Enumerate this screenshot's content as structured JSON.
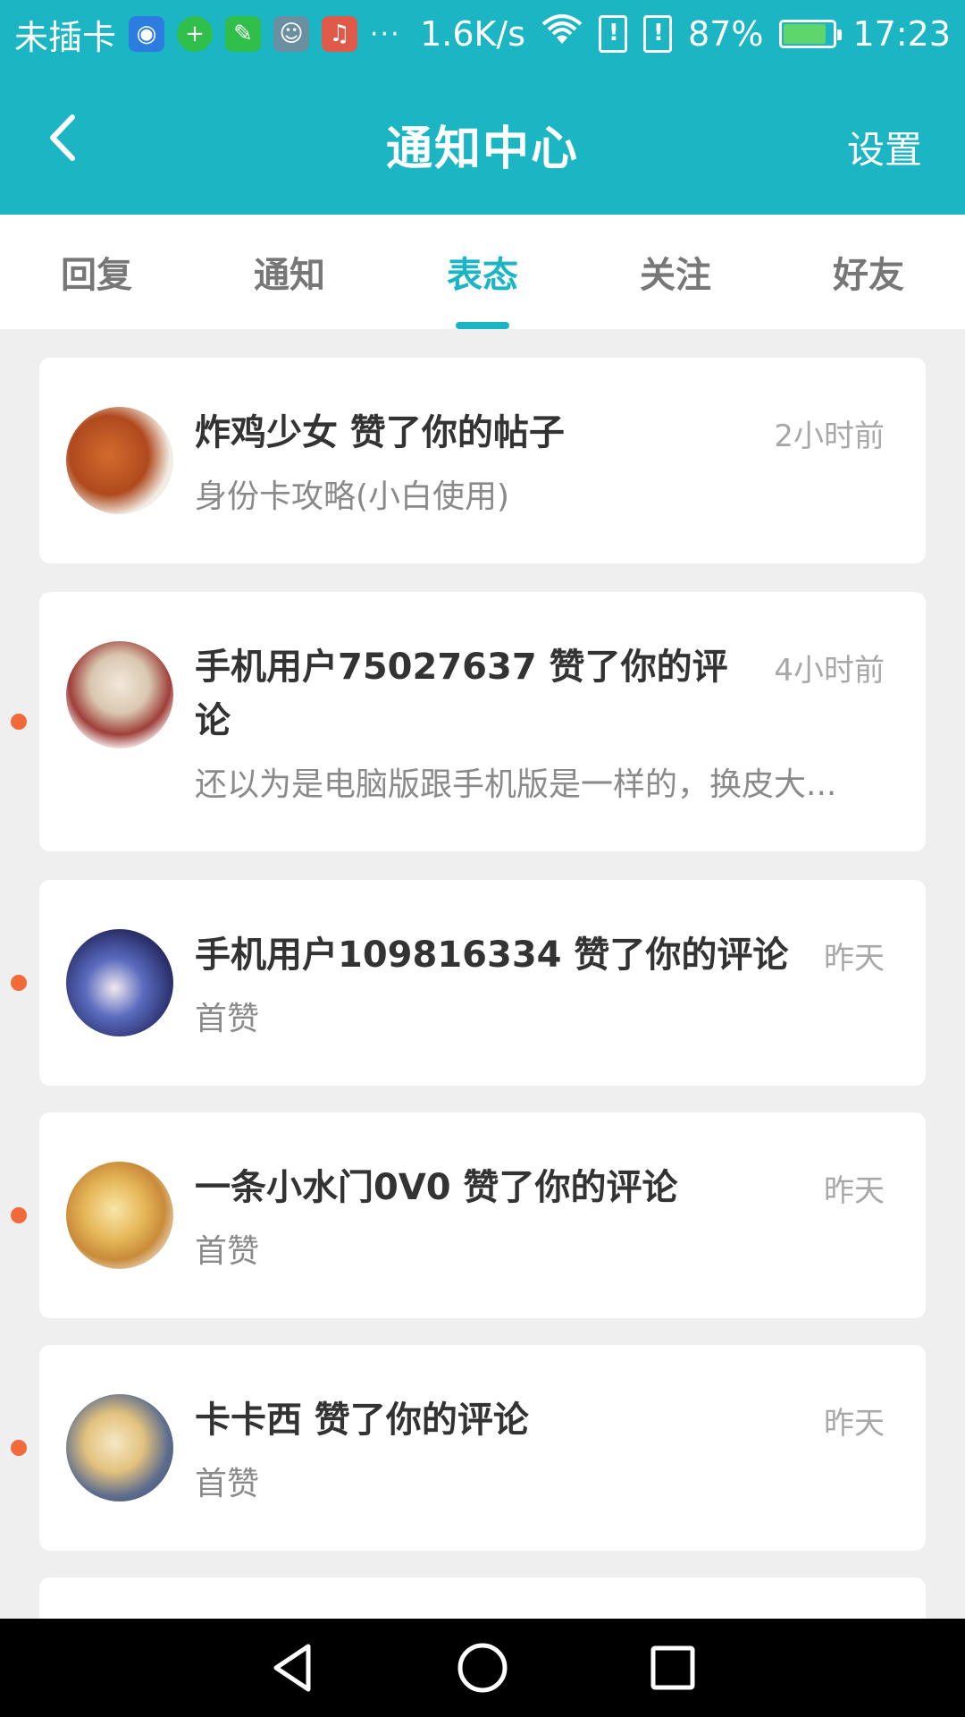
{
  "status_bar": {
    "carrier": "未插卡",
    "apps": [
      "wifi-hotspot-icon",
      "green-plus-icon",
      "green-app-icon",
      "character-app-icon",
      "music-icon"
    ],
    "more": "···",
    "net_speed": "1.6K/s",
    "battery_percent": "87%",
    "battery_level": 0.87,
    "time": "17:23"
  },
  "header": {
    "title": "通知中心",
    "settings_label": "设置",
    "back_icon": "chevron-left-icon"
  },
  "tabs": [
    {
      "label": "回复",
      "active": false
    },
    {
      "label": "通知",
      "active": false
    },
    {
      "label": "表态",
      "active": true
    },
    {
      "label": "关注",
      "active": false
    },
    {
      "label": "好友",
      "active": false
    }
  ],
  "notifications": [
    {
      "title": "炸鸡少女 赞了你的帖子",
      "subtitle": "身份卡攻略(小白使用)",
      "time": "2小时前",
      "unread": false
    },
    {
      "title": "手机用户75027637 赞了你的评论",
      "subtitle": "还以为是电脑版跟手机版是一样的，换皮大...",
      "time": "4小时前",
      "unread": true
    },
    {
      "title": "手机用户109816334 赞了你的评论",
      "subtitle": "首赞",
      "time": "昨天",
      "unread": true
    },
    {
      "title": "一条小水门0V0 赞了你的评论",
      "subtitle": "首赞",
      "time": "昨天",
      "unread": true
    },
    {
      "title": "卡卡西 赞了你的评论",
      "subtitle": "首赞",
      "time": "昨天",
      "unread": true
    }
  ],
  "colors": {
    "accent": "#1bb5c4",
    "unread_dot": "#f26a3a",
    "background": "#efefef"
  },
  "nav": {
    "back": "triangle-back-icon",
    "home": "circle-home-icon",
    "recents": "square-recents-icon"
  }
}
